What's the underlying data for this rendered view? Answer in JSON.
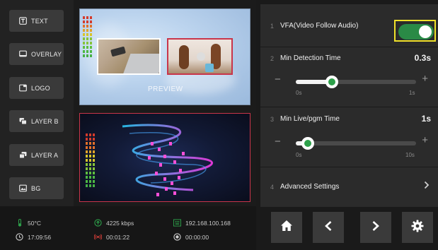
{
  "left_buttons": [
    {
      "label": "TEXT",
      "icon": "text-icon"
    },
    {
      "label": "OVERLAY",
      "icon": "overlay-icon"
    },
    {
      "label": "LOGO",
      "icon": "logo-icon"
    },
    {
      "label": "LAYER B",
      "icon": "layer-b-icon"
    },
    {
      "label": "LAYER A",
      "icon": "layer-a-icon"
    },
    {
      "label": "BG",
      "icon": "image-icon"
    }
  ],
  "preview": {
    "label": "PREVIEW"
  },
  "status": {
    "temperature": "50°C",
    "time": "17:09:56",
    "bitrate": "4225 kbps",
    "live_duration": "00:01:22",
    "ip": "192.168.100.168",
    "record_duration": "00:00:00"
  },
  "settings": {
    "vfa": {
      "num": "1",
      "title": "VFA(Video Follow Audio)",
      "enabled": true
    },
    "min_detection": {
      "num": "2",
      "title": "Min Detection Time",
      "value": "0.3s",
      "min_label": "0s",
      "max_label": "1s",
      "minus": "−",
      "plus": "+",
      "level": 0.3
    },
    "min_live": {
      "num": "3",
      "title": "Min Live/pgm Time",
      "value": "1s",
      "min_label": "0s",
      "max_label": "10s",
      "minus": "−",
      "plus": "+",
      "level": 0.1
    },
    "advanced": {
      "num": "4",
      "title": "Advanced Settings"
    }
  },
  "nav": {
    "home": "home-icon",
    "back": "chevron-left-icon",
    "forward": "chevron-right-icon",
    "settings": "gear-icon"
  },
  "colors": {
    "accent_green": "#2da04a",
    "toggle_on": "#2a8a46",
    "highlight": "#f0e12a",
    "program_border": "#c9354a"
  }
}
